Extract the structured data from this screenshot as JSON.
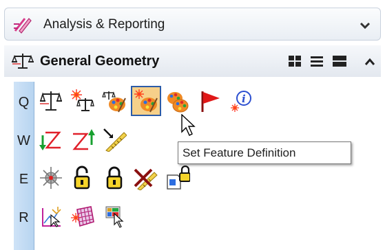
{
  "workflow": {
    "label": "Analysis & Reporting",
    "icon": "analysis-pencil-icon",
    "chevron": "chevron-down-icon"
  },
  "group": {
    "title": "General Geometry",
    "icon": "balance-scale-icon",
    "view_buttons": [
      "large-icons-view-icon",
      "list-view-icon",
      "wide-view-icon"
    ],
    "collapse_icon": "chevron-up-icon"
  },
  "rows": [
    {
      "key": "Q",
      "tools": [
        "measure-scale-icon",
        "highlight-scale-icon",
        "palette-scale-icon",
        "set-feature-definition-icon",
        "copy-palette-icon",
        "red-flag-icon",
        "info-icon"
      ]
    },
    {
      "key": "W",
      "tools": [
        "direction-green-arrow-icon",
        "direction-red-arrow-icon",
        "ruler-arrow-icon"
      ]
    },
    {
      "key": "E",
      "tools": [
        "target-element-icon",
        "unlock-padlock-icon",
        "lock-padlock-icon",
        "delete-ruler-icon",
        "document-lock-icon"
      ]
    },
    {
      "key": "R",
      "tools": [
        "select-element-icon",
        "mesh-highlight-icon",
        "cursor-pick-icon"
      ]
    }
  ],
  "selected_tool": "set-feature-definition-icon",
  "tooltip": {
    "text": "Set Feature Definition"
  },
  "colors": {
    "key_column": "#b7d4f0",
    "selection_border": "#2b5ba8",
    "selection_fill": "#f6d08a",
    "tooltip_border": "#767676"
  }
}
